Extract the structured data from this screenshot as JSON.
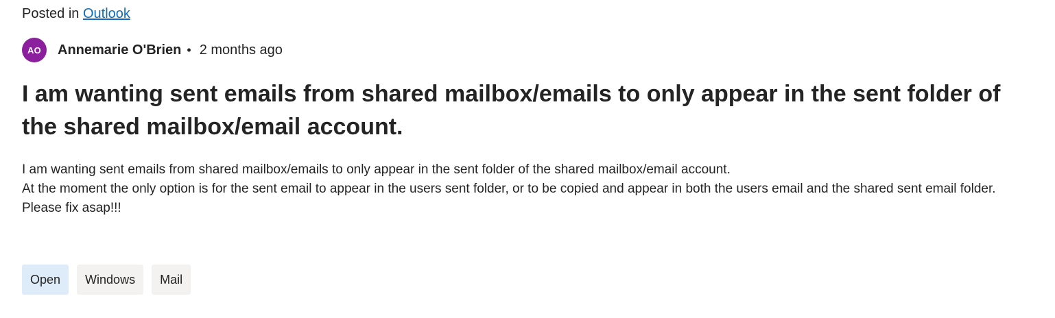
{
  "header": {
    "posted_in_label": "Posted in",
    "category_link": "Outlook"
  },
  "author": {
    "initials": "AO",
    "name": "Annemarie O'Brien",
    "separator": "•",
    "time": "2 months ago",
    "avatar_color": "#8b1f9e"
  },
  "post": {
    "title": "I am wanting sent emails from shared mailbox/emails to only appear in the sent folder of the shared mailbox/email account.",
    "body_lines": [
      "I am wanting sent emails from shared mailbox/emails to only appear in the sent folder of the shared mailbox/email account.",
      "At the moment the only option is for the sent email to appear in the users sent folder, or to be copied and appear in both the users email and the shared sent email folder.",
      "Please fix asap!!!"
    ]
  },
  "tags": [
    {
      "label": "Open",
      "color": "#deecf9"
    },
    {
      "label": "Windows",
      "color": "#f3f2f1"
    },
    {
      "label": "Mail",
      "color": "#f3f2f1"
    }
  ],
  "colors": {
    "link": "#0f6cbd",
    "text": "#242424"
  }
}
